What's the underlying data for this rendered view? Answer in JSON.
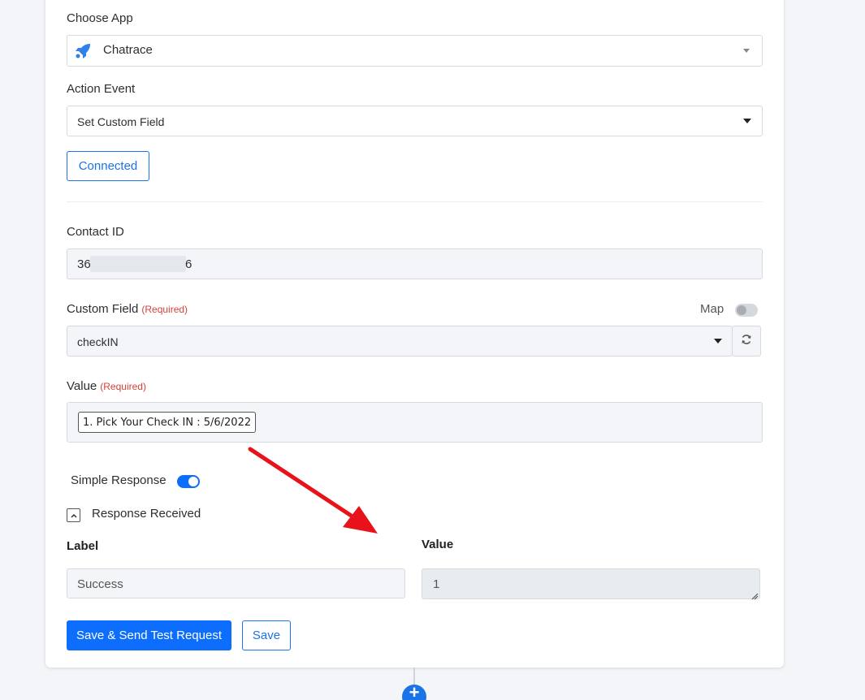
{
  "choose_app": {
    "label": "Choose App",
    "selected": "Chatrace",
    "icon": "rocket-icon"
  },
  "action_event": {
    "label": "Action Event",
    "selected": "Set Custom Field"
  },
  "connected_label": "Connected",
  "contact_id": {
    "label": "Contact ID",
    "value_start": "36",
    "value_end": "6"
  },
  "custom_field": {
    "label": "Custom Field",
    "required": "(Required)",
    "map_label": "Map",
    "selected": "checkIN"
  },
  "value_field": {
    "label": "Value",
    "required": "(Required)",
    "pill": "1. Pick Your Check IN : 5/6/2022"
  },
  "simple_response": {
    "label": "Simple Response",
    "enabled": true
  },
  "response_received": {
    "label": "Response Received",
    "columns": {
      "label": "Label",
      "value": "Value"
    },
    "rows": [
      {
        "label": "Success",
        "value": "1"
      }
    ]
  },
  "buttons": {
    "save_send": "Save & Send Test Request",
    "save": "Save"
  },
  "add_step": "+",
  "colors": {
    "accent": "#0d6efd",
    "required": "#d4413b",
    "arrow": "#e8121a"
  }
}
